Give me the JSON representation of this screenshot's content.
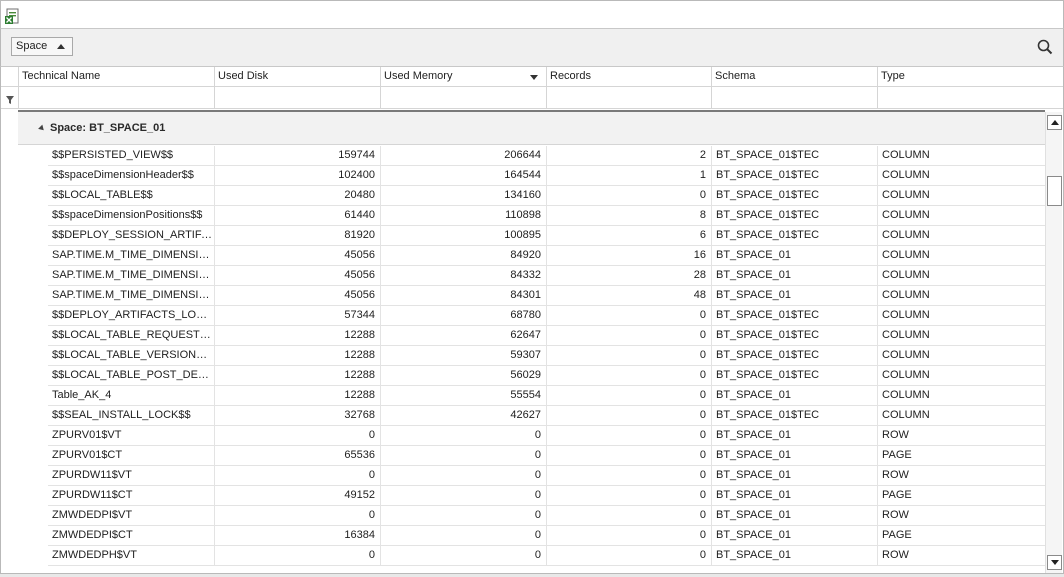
{
  "toolbar": {
    "export_icon": "excel-export-icon"
  },
  "groupbar": {
    "group_chip_label": "Space",
    "search_icon": "search-icon"
  },
  "grid": {
    "columns": [
      "Technical Name",
      "Used Disk",
      "Used Memory",
      "Records",
      "Schema",
      "Type"
    ],
    "sorted_column": "Used Memory",
    "sort_direction": "descending",
    "group_label": "Space: BT_SPACE_01",
    "rows": [
      [
        "$$PERSISTED_VIEW$$",
        "159744",
        "206644",
        "2",
        "BT_SPACE_01$TEC",
        "COLUMN"
      ],
      [
        "$$spaceDimensionHeader$$",
        "102400",
        "164544",
        "1",
        "BT_SPACE_01$TEC",
        "COLUMN"
      ],
      [
        "$$LOCAL_TABLE$$",
        "20480",
        "134160",
        "0",
        "BT_SPACE_01$TEC",
        "COLUMN"
      ],
      [
        "$$spaceDimensionPositions$$",
        "61440",
        "110898",
        "8",
        "BT_SPACE_01$TEC",
        "COLUMN"
      ],
      [
        "$$DEPLOY_SESSION_ARTIFA...",
        "81920",
        "100895",
        "6",
        "BT_SPACE_01$TEC",
        "COLUMN"
      ],
      [
        "SAP.TIME.M_TIME_DIMENSIO...",
        "45056",
        "84920",
        "16",
        "BT_SPACE_01",
        "COLUMN"
      ],
      [
        "SAP.TIME.M_TIME_DIMENSIO...",
        "45056",
        "84332",
        "28",
        "BT_SPACE_01",
        "COLUMN"
      ],
      [
        "SAP.TIME.M_TIME_DIMENSIO...",
        "45056",
        "84301",
        "48",
        "BT_SPACE_01",
        "COLUMN"
      ],
      [
        "$$DEPLOY_ARTIFACTS_LOCK$$",
        "57344",
        "68780",
        "0",
        "BT_SPACE_01$TEC",
        "COLUMN"
      ],
      [
        "$$LOCAL_TABLE_REQUESTS$$",
        "12288",
        "62647",
        "0",
        "BT_SPACE_01$TEC",
        "COLUMN"
      ],
      [
        "$$LOCAL_TABLE_VERSIONS$$",
        "12288",
        "59307",
        "0",
        "BT_SPACE_01$TEC",
        "COLUMN"
      ],
      [
        "$$LOCAL_TABLE_POST_DEPL...",
        "12288",
        "56029",
        "0",
        "BT_SPACE_01$TEC",
        "COLUMN"
      ],
      [
        "Table_AK_4",
        "12288",
        "55554",
        "0",
        "BT_SPACE_01",
        "COLUMN"
      ],
      [
        "$$SEAL_INSTALL_LOCK$$",
        "32768",
        "42627",
        "0",
        "BT_SPACE_01$TEC",
        "COLUMN"
      ],
      [
        "ZPURV01$VT",
        "0",
        "0",
        "0",
        "BT_SPACE_01",
        "ROW"
      ],
      [
        "ZPURV01$CT",
        "65536",
        "0",
        "0",
        "BT_SPACE_01",
        "PAGE"
      ],
      [
        "ZPURDW11$VT",
        "0",
        "0",
        "0",
        "BT_SPACE_01",
        "ROW"
      ],
      [
        "ZPURDW11$CT",
        "49152",
        "0",
        "0",
        "BT_SPACE_01",
        "PAGE"
      ],
      [
        "ZMWDEDPI$VT",
        "0",
        "0",
        "0",
        "BT_SPACE_01",
        "ROW"
      ],
      [
        "ZMWDEDPI$CT",
        "16384",
        "0",
        "0",
        "BT_SPACE_01",
        "PAGE"
      ],
      [
        "ZMWDEDPH$VT",
        "0",
        "0",
        "0",
        "BT_SPACE_01",
        "ROW"
      ]
    ]
  }
}
